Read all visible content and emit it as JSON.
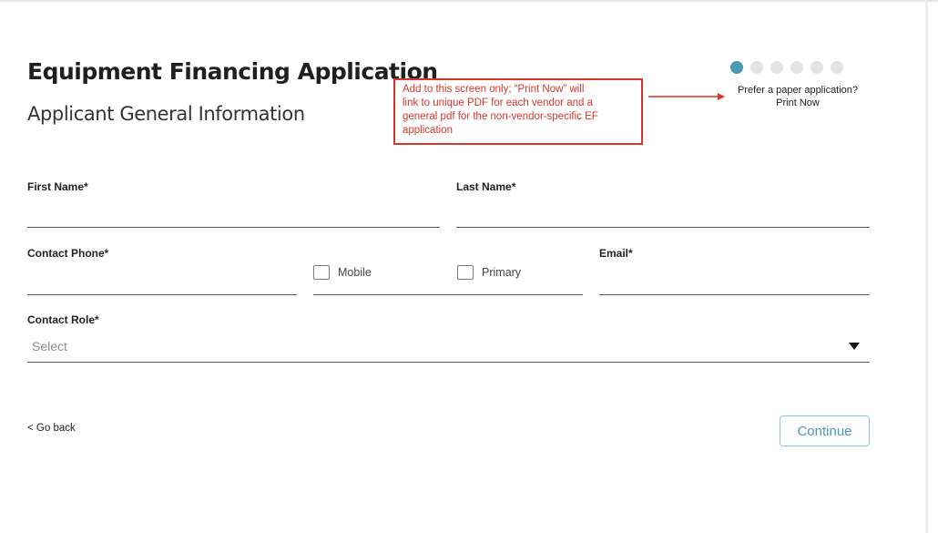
{
  "header": {
    "title": "Equipment Financing Application",
    "subtitle": "Applicant General Information"
  },
  "stepper": {
    "total_steps": 6,
    "current_step": 1,
    "active_color": "#4a9ab5",
    "inactive_color": "#e3e4e6"
  },
  "paper_application": {
    "prompt": "Prefer a paper application?",
    "link_label": "Print Now"
  },
  "annotation": {
    "lines": [
      "Add to this screen only; “Print Now” will",
      "link to unique PDF for each vendor and a",
      "general pdf for the non-vendor-specific EF",
      "application"
    ],
    "color": "#d9352b"
  },
  "form": {
    "first_name": {
      "label": "First Name*",
      "value": ""
    },
    "last_name": {
      "label": "Last Name*",
      "value": ""
    },
    "contact_phone": {
      "label": "Contact Phone*",
      "value": ""
    },
    "mobile_checkbox": {
      "label": "Mobile",
      "checked": false
    },
    "primary_checkbox": {
      "label": "Primary",
      "checked": false
    },
    "email": {
      "label": "Email*",
      "value": ""
    },
    "contact_role": {
      "label": "Contact Role*",
      "placeholder": "Select"
    }
  },
  "footer": {
    "back_label": "< Go back",
    "continue_label": "Continue"
  }
}
